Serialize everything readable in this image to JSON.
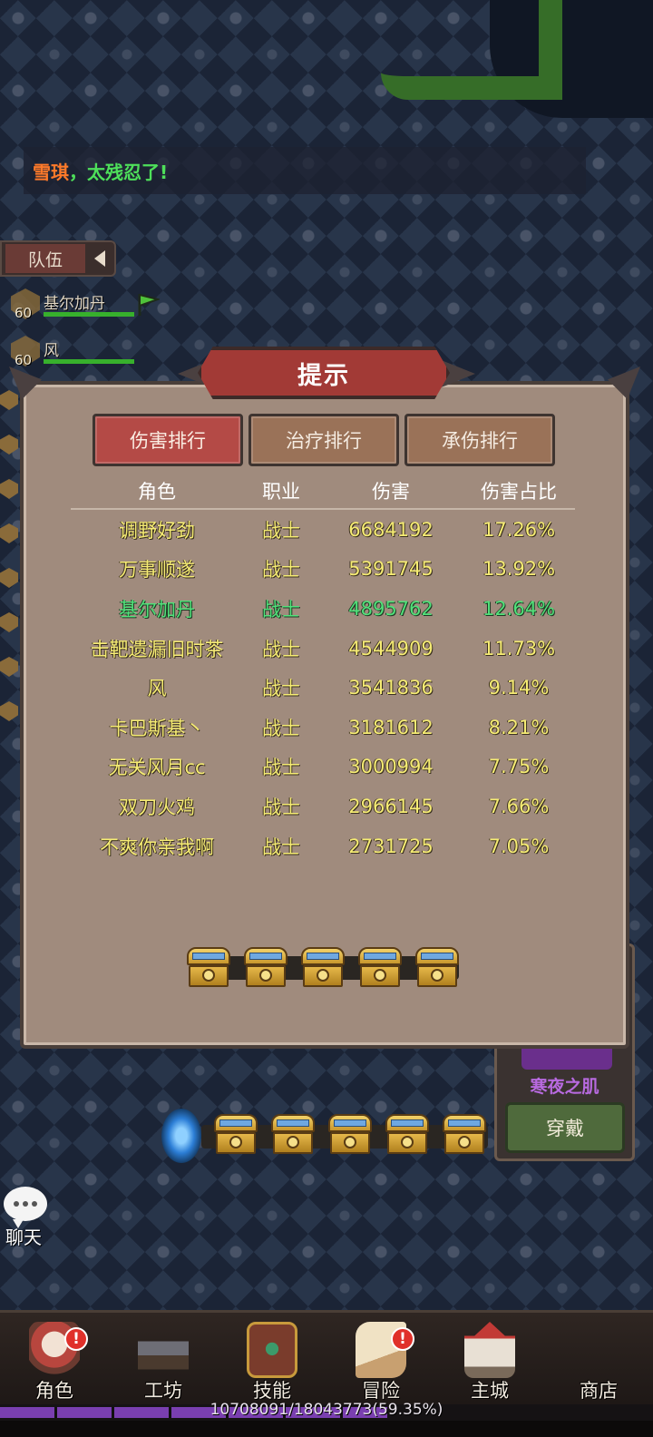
{
  "chat": {
    "speaker": "雪琪",
    "message": "，太残忍了!"
  },
  "team": {
    "tab_label": "队伍",
    "members": [
      {
        "level": "60",
        "name": "基尔加丹"
      },
      {
        "level": "60",
        "name": "风"
      }
    ]
  },
  "dialog": {
    "title": "提示",
    "tabs": [
      {
        "label": "伤害排行",
        "active": true
      },
      {
        "label": "治疗排行",
        "active": false
      },
      {
        "label": "承伤排行",
        "active": false
      }
    ],
    "columns": [
      "角色",
      "职业",
      "伤害",
      "伤害占比"
    ],
    "rows": [
      {
        "name": "调野好劲",
        "class": "战士",
        "damage": "6684192",
        "share": "17.26%"
      },
      {
        "name": "万事顺遂",
        "class": "战士",
        "damage": "5391745",
        "share": "13.92%"
      },
      {
        "name": "基尔加丹",
        "class": "战士",
        "damage": "4895762",
        "share": "12.64%"
      },
      {
        "name": "击靶遗漏旧时茶",
        "class": "战士",
        "damage": "4544909",
        "share": "11.73%"
      },
      {
        "name": "风",
        "class": "战士",
        "damage": "3541836",
        "share": "9.14%"
      },
      {
        "name": "卡巴斯基丶",
        "class": "战士",
        "damage": "3181612",
        "share": "8.21%"
      },
      {
        "name": "无关风月cc",
        "class": "战士",
        "damage": "3000994",
        "share": "7.75%"
      },
      {
        "name": "双刀火鸡",
        "class": "战士",
        "damage": "2966145",
        "share": "7.66%"
      },
      {
        "name": "不爽你亲我啊",
        "class": "战士",
        "damage": "2731725",
        "share": "7.05%"
      }
    ]
  },
  "equipment": {
    "item_name": "寒夜之肌",
    "wear_label": "穿戴"
  },
  "chat_button": {
    "label": "聊天"
  },
  "nav": [
    {
      "label": "角色",
      "icon": "character-icon",
      "badge": "!"
    },
    {
      "label": "工坊",
      "icon": "anvil-icon",
      "badge": ""
    },
    {
      "label": "技能",
      "icon": "skill-book-icon",
      "badge": ""
    },
    {
      "label": "冒险",
      "icon": "adventure-scroll-icon",
      "badge": "!"
    },
    {
      "label": "主城",
      "icon": "castle-icon",
      "badge": ""
    },
    {
      "label": "商店",
      "icon": "shop-icon",
      "badge": ""
    }
  ],
  "experience": {
    "text": "10708091/18043773(59.35%)",
    "fraction": 0.5935
  },
  "colors": {
    "damage_text": "#f6ec74",
    "self_text": "#52e07a",
    "active_tab": "#b44a46",
    "inactive_tab": "#9a7258"
  }
}
